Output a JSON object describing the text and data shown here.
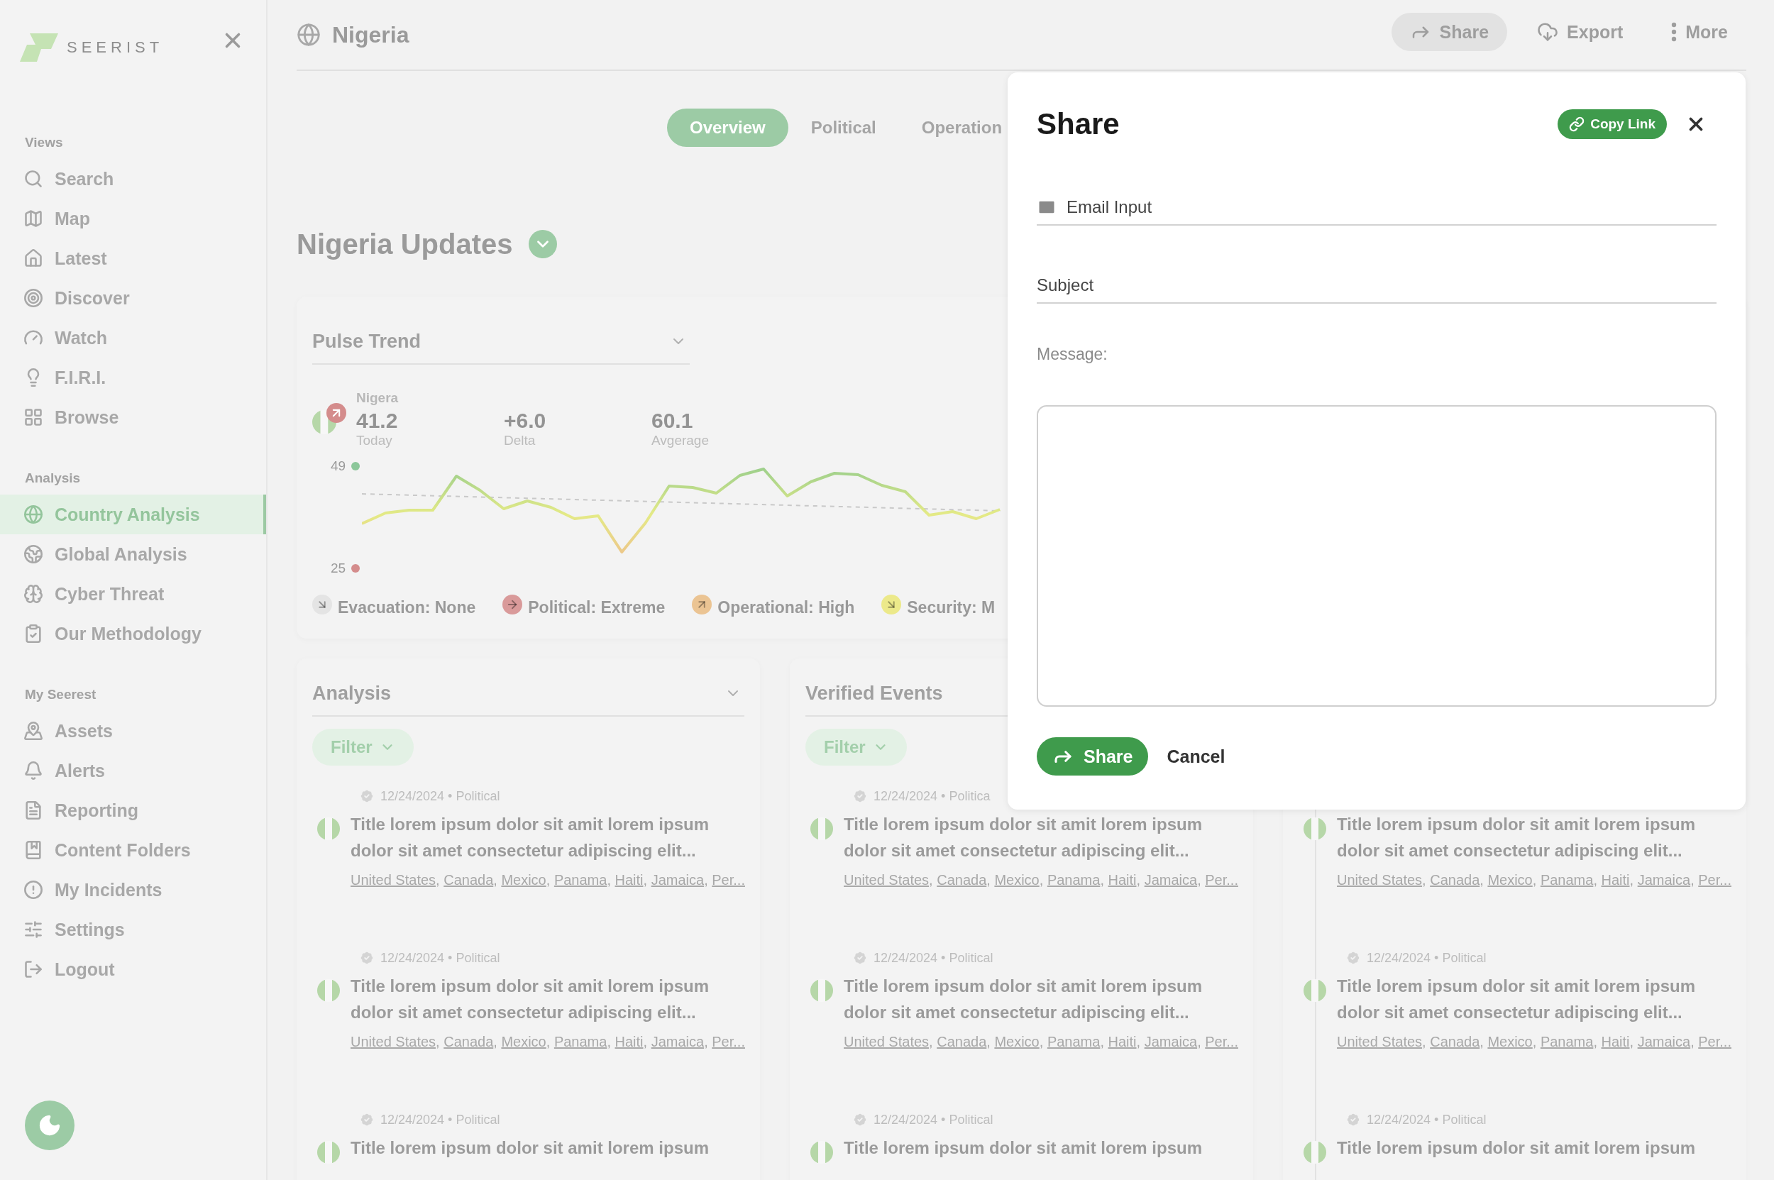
{
  "sidebar": {
    "brand": "SEERIST",
    "sections": [
      {
        "label": "Views",
        "items": [
          {
            "label": "Search",
            "selected": false
          },
          {
            "label": "Map",
            "selected": false
          },
          {
            "label": "Latest",
            "selected": false
          },
          {
            "label": "Discover",
            "selected": false
          },
          {
            "label": "Watch",
            "selected": false
          },
          {
            "label": "F.I.R.I.",
            "selected": false
          },
          {
            "label": "Browse",
            "selected": false
          }
        ]
      },
      {
        "label": "Analysis",
        "items": [
          {
            "label": "Country Analysis",
            "selected": true
          },
          {
            "label": "Global Analysis",
            "selected": false
          },
          {
            "label": "Cyber Threat",
            "selected": false
          },
          {
            "label": "Our Methodology",
            "selected": false
          }
        ]
      },
      {
        "label": "My Seerest",
        "items": [
          {
            "label": "Assets",
            "selected": false
          },
          {
            "label": "Alerts",
            "selected": false
          },
          {
            "label": "Reporting",
            "selected": false
          },
          {
            "label": "Content Folders",
            "selected": false
          },
          {
            "label": "My Incidents",
            "selected": false
          },
          {
            "label": "Settings",
            "selected": false
          },
          {
            "label": "Logout",
            "selected": false
          }
        ]
      }
    ]
  },
  "header": {
    "title": "Nigeria",
    "actions": [
      {
        "label": "Share",
        "active": true
      },
      {
        "label": "Export",
        "active": false
      },
      {
        "label": "More",
        "active": false
      }
    ]
  },
  "tabs": [
    {
      "label": "Overview",
      "selected": true
    },
    {
      "label": "Political",
      "selected": false
    },
    {
      "label": "Operation",
      "selected": false
    }
  ],
  "heading": "Nigeria Updates",
  "pulse": {
    "title": "Pulse Trend",
    "country": "Nigera",
    "stats": [
      {
        "value": "41.2",
        "label": "Today"
      },
      {
        "value": "+6.0",
        "label": "Delta"
      },
      {
        "value": "60.1",
        "label": "Avgerage"
      }
    ],
    "high": "49",
    "low": "25",
    "legend": [
      {
        "label": "Evacuation: None",
        "color": "#e4e4e4",
        "kind": "down"
      },
      {
        "label": "Political: Extreme",
        "color": "#d99a9a",
        "kind": "right"
      },
      {
        "label": "Operational: High",
        "color": "#ebc493",
        "kind": "up"
      },
      {
        "label": "Security: M",
        "color": "#ece98a",
        "kind": "down"
      }
    ]
  },
  "list_separator": ",",
  "cards": [
    {
      "title": "Analysis",
      "filter": "Filter",
      "expandable": true,
      "timeline": false,
      "items": [
        {
          "meta": "12/24/2024 • Political",
          "title": "Title lorem ipsum dolor sit amit lorem ipsum dolor sit amet consectetur adipiscing elit...",
          "countries": [
            "United States",
            "Canada",
            "Mexico",
            "Panama",
            "Haiti",
            "Jamaica",
            "Per..."
          ]
        },
        {
          "meta": "12/24/2024 • Political",
          "title": "Title lorem ipsum dolor sit amit lorem ipsum dolor sit amet consectetur adipiscing elit...",
          "countries": [
            "United States",
            "Canada",
            "Mexico",
            "Panama",
            "Haiti",
            "Jamaica",
            "Per..."
          ]
        },
        {
          "meta": "12/24/2024 • Political",
          "title": "Title lorem ipsum dolor sit amit lorem ipsum"
        }
      ]
    },
    {
      "title": "Verified Events",
      "filter": "Filter",
      "timeline": false,
      "items": [
        {
          "meta": "12/24/2024 • Politica",
          "title": "Title lorem ipsum dolor sit amit lorem ipsum dolor sit amet consectetur adipiscing elit...",
          "countries": [
            "United States",
            "Canada",
            "Mexico",
            "Panama",
            "Haiti",
            "Jamaica",
            "Per..."
          ]
        },
        {
          "meta": "12/24/2024 • Political",
          "title": "Title lorem ipsum dolor sit amit lorem ipsum dolor sit amet consectetur adipiscing elit...",
          "countries": [
            "United States",
            "Canada",
            "Mexico",
            "Panama",
            "Haiti",
            "Jamaica",
            "Per..."
          ]
        },
        {
          "meta": "12/24/2024 • Political",
          "title": "Title lorem ipsum dolor sit amit lorem ipsum"
        }
      ]
    },
    {
      "timeline": true,
      "items": [
        {
          "title": "Title lorem ipsum dolor sit amit lorem ipsum dolor sit amet consectetur adipiscing elit...",
          "countries": [
            "United States",
            "Canada",
            "Mexico",
            "Panama",
            "Haiti",
            "Jamaica",
            "Per..."
          ]
        },
        {
          "meta": "12/24/2024 • Political",
          "title": "Title lorem ipsum dolor sit amit lorem ipsum dolor sit amet consectetur adipiscing elit...",
          "countries": [
            "United States",
            "Canada",
            "Mexico",
            "Panama",
            "Haiti",
            "Jamaica",
            "Per..."
          ]
        },
        {
          "meta": "12/24/2024 • Political",
          "title": "Title lorem ipsum dolor sit amit lorem ipsum"
        }
      ]
    }
  ],
  "share_dialog": {
    "title": "Share",
    "copy_link": "Copy Link",
    "email_placeholder": "Email Input",
    "subject_placeholder": "Subject",
    "message_label": "Message:",
    "submit": "Share",
    "cancel": "Cancel"
  }
}
